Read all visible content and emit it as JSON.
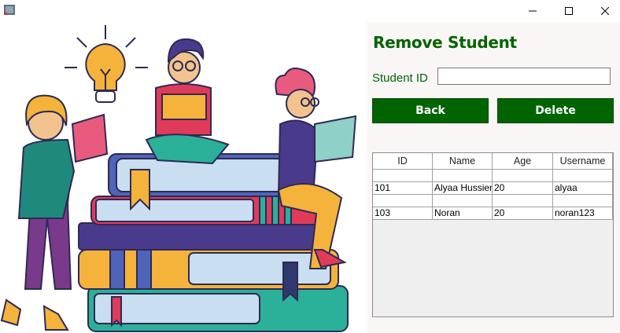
{
  "window": {
    "minimize_icon": "minimize-icon",
    "maximize_icon": "maximize-icon",
    "close_icon": "close-icon"
  },
  "form": {
    "title": "Remove Student",
    "student_id_label": "Student ID",
    "student_id_value": "",
    "back_label": "Back",
    "delete_label": "Delete"
  },
  "table": {
    "headers": [
      "ID",
      "Name",
      "Age",
      "Username"
    ],
    "rows": [
      [
        "",
        "",
        "",
        ""
      ],
      [
        "101",
        "Alyaa Hussien",
        "20",
        "alyaa"
      ],
      [
        "",
        "",
        "",
        ""
      ],
      [
        "103",
        "Noran",
        "20",
        "noran123"
      ]
    ]
  },
  "colors": {
    "accent": "#006400",
    "panel_bg": "#faf6f6"
  }
}
